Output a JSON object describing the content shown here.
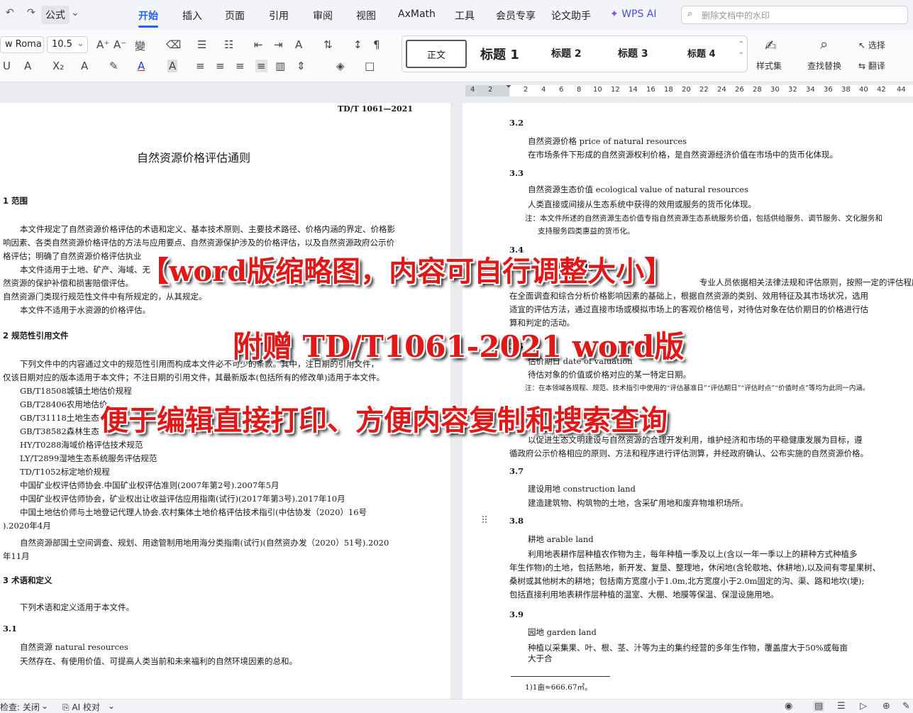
{
  "menubar": {
    "undo": "↶",
    "redo": "↷",
    "formula": "公式",
    "items": [
      "开始",
      "插入",
      "页面",
      "引用",
      "审阅",
      "视图",
      "AxMath",
      "工具",
      "会员专享",
      "论文助手",
      "WPS AI"
    ],
    "search_placeholder": "删除文档中的水印"
  },
  "ribbon": {
    "font_name": "w Roma",
    "font_size": "10.5",
    "styles": [
      "正文",
      "标题 1",
      "标题 2",
      "标题 3",
      "标题 4"
    ],
    "styles_set": "样式集",
    "find_replace": "查找替换",
    "select": "选择",
    "translate": "翻译"
  },
  "ruler": {
    "numbers": [
      "4",
      "2",
      "2",
      "4",
      "6",
      "8",
      "10",
      "12",
      "14",
      "16",
      "18",
      "20",
      "22",
      "24",
      "26",
      "28",
      "30",
      "32",
      "34",
      "36",
      "38",
      "40",
      "42",
      "44"
    ]
  },
  "left_page": {
    "header": "TD/T 1061—2021",
    "title": "自然资源价格评估通则",
    "lines": [
      "1  范围",
      "本文件规定了自然资源价格评估的术语和定义、基本技术原则、主要技术路径、价格内涵的界定、价格影",
      "响因素、各类自然资源价格评估的方法与应用要点、自然资源保护涉及的价格评估，以及自然资源政府公示价",
      "格评估；明确了自然资源价格评估执业",
      "本文件适用于土地、矿产、海域、无",
      "然资源的保护补偿和损害赔偿评估。",
      "自然资源门类现行规范性文件中有所规定的，从其规定。",
      "本文件不适用于水资源的价格评估。",
      "2  规范性引用文件",
      "下列文件中的内容通过文中的规范性引用而构成本文件必不可少的条款。其中，注日期的引用文件，",
      "仅该日期对应的版本适用于本文件；不注日期的引用文件，其最新版本(包括所有的修改单)适用于本文件。",
      "GB/T18508城镇土地估价规程",
      "GB/T28406农用地估价",
      "GB/T31118土地生态",
      "GB/T38582森林生态",
      "HY/T0288海域价格评估技术规范",
      "LY/T2899湿地生态系统服务评估规范",
      "TD/T1052标定地价规程",
      "中国矿业权评估师协会.中国矿业权评估准则(2007年第2号).2007年5月",
      "中国矿业权评估师协会，矿业权出让收益评估应用指南(试行)(2017年第3号).2017年10月",
      "中国土地估价师与土地登记代理人协会.农村集体土地价格评估技术指引(中估协发（2020）16号",
      ").2020年4月",
      "自然资源部国土空间调查、规划、用途管制用地用海分类指南(试行)(自然资办发（2020）51号).2020",
      "年11月",
      "3  术语和定义",
      "下列术语和定义适用于本文件。",
      "3.1",
      "自然资源   natural resources",
      "天然存在、有使用价值、可提高人类当前和未来福利的自然环境因素的总和。"
    ]
  },
  "right_page": {
    "lines": [
      "3.2",
      "自然资源价格  price of natural resources",
      "在市场条件下形成的自然资源权利价格，是自然资源经济价值在市场中的货币化体现。",
      "3.3",
      "自然资源生态价值  ecological value of natural resources",
      "人类直接或间接从生态系统中获得的效用或服务的货币化体现。",
      "注：本文件所述的自然资源生态价值专指自然资源生态系统服务价值，包括供给服务、调节服务、文化服务和",
      "支持服务四类惠益的货币化。",
      "3.4",
      "自然资源价格评估",
      "专业人员依据相关法律法规和评估原则，按照一定的评估程序，",
      "在全面调查和综合分析价格影响因素的基础上，根据自然资源的类别、效用特征及其市场状况，选用",
      "适宜的评估方法，通过直接市场或模拟市场上的客观价格信号，对待估对象在估价期日的价格进行估",
      "算和判定的活动。",
      "3.5",
      "估价期日  date of valuation",
      "待估对象的价值或价格对应的某一特定日期。",
      "注：在本领域各规程、规范、技术指引中使用的“评估基准日”“评估期日”“评估时点”“价值时点”等均为此同一内涵。",
      "3.6",
      "以促进生态文明建设与自然资源的合理开发利用，维护经济和市场的平稳健康发展为目标，遵",
      "循政府公示价格相应的原则、方法和程序进行评估测算，并经政府确认、公布实施的自然资源价格。",
      "3.7",
      "建设用地  construction land",
      "建造建筑物、构筑物的土地，含采矿用地和废弃物堆积场所。",
      "3.8",
      "耕地  arable land",
      "利用地表耕作层种植农作物为主，每年种植一季及以上(含以一年一季以上的耕种方式种植多",
      "年生作物)的土地，包括熟地，新开发、复垦、整理地，休闲地(含轮歇地、休耕地),以及间有零星果树、",
      "桑树或其他树木的耕地；包括南方宽度小于1.0m,北方宽度小于2.0m固定的沟、渠、路和地坎(埂);",
      "包括直接利用地表耕作层种植的温室、大棚、地膜等保温、保湿设施用地。",
      "3.9",
      "园地  garden land",
      "种植以采集果、叶、根、茎、汁等为主的集约经营的多年生作物，覆盖度大于50%或每亩",
      "大于合",
      "1)1亩≈666.67㎡。"
    ]
  },
  "overlays": {
    "line1": "【word版缩略图，内容可自行调整大小】",
    "line2": "附赠 TD/T1061-2021 word版",
    "line3": "便于编辑直接打印、方便内容复制和搜索查询"
  },
  "statusbar": {
    "check": "检查: 关闭",
    "ai_proof": "AI 校对"
  },
  "colors": {
    "accent": "#2361e8",
    "overlay_text": "#e01818"
  }
}
